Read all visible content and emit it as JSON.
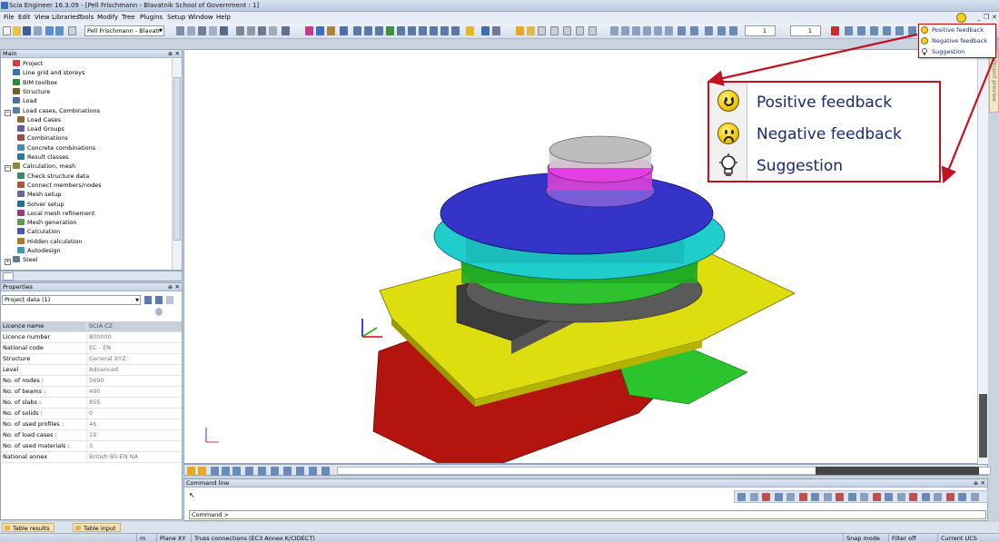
{
  "window": {
    "title": "Scia Engineer 16.3.09 - [Pell Frischmann - Blavatnik School of Government : 1]"
  },
  "menu": [
    "File",
    "Edit",
    "View",
    "Libraries",
    "Tools",
    "Modify",
    "Tree",
    "Plugins",
    "Setup",
    "Window",
    "Help"
  ],
  "window_controls": {
    "minimize": "_",
    "restore": "❒",
    "close": "✕"
  },
  "toolbar": {
    "project_combo": "Pell Frischmann - Blavatr",
    "spin1": "1",
    "spin2": "1"
  },
  "feedback_menu": {
    "items": [
      {
        "label": "Positive feedback",
        "icon": "smile-icon"
      },
      {
        "label": "Negative feedback",
        "icon": "sad-icon"
      },
      {
        "label": "Suggestion",
        "icon": "bulb-icon"
      }
    ]
  },
  "main_panel": {
    "title": "Main",
    "tree": [
      {
        "label": "Project",
        "level": 0,
        "icon": "project-icon",
        "expander": ""
      },
      {
        "label": "Line grid and storeys",
        "level": 0,
        "icon": "grid-icon",
        "expander": ""
      },
      {
        "label": "BIM toolbox",
        "level": 0,
        "icon": "bim-icon",
        "expander": ""
      },
      {
        "label": "Structure",
        "level": 0,
        "icon": "structure-icon",
        "expander": ""
      },
      {
        "label": "Load",
        "level": 0,
        "icon": "load-icon",
        "expander": ""
      },
      {
        "label": "Load cases, Combinations",
        "level": 0,
        "icon": "loadcases-icon",
        "expander": "−"
      },
      {
        "label": "Load Cases",
        "level": 1,
        "icon": "loadcase-icon",
        "expander": ""
      },
      {
        "label": "Load Groups",
        "level": 1,
        "icon": "loadgroup-icon",
        "expander": ""
      },
      {
        "label": "Combinations",
        "level": 1,
        "icon": "combination-icon",
        "expander": ""
      },
      {
        "label": "Concrete combinations",
        "level": 1,
        "icon": "concrete-combination-icon",
        "expander": ""
      },
      {
        "label": "Result classes",
        "level": 1,
        "icon": "result-class-icon",
        "expander": ""
      },
      {
        "label": "Calculation, mesh",
        "level": 0,
        "icon": "calculation-icon",
        "expander": "−"
      },
      {
        "label": "Check structure data",
        "level": 1,
        "icon": "check-icon",
        "expander": ""
      },
      {
        "label": "Connect members/nodes",
        "level": 1,
        "icon": "connect-icon",
        "expander": ""
      },
      {
        "label": "Mesh setup",
        "level": 1,
        "icon": "mesh-setup-icon",
        "expander": ""
      },
      {
        "label": "Solver setup",
        "level": 1,
        "icon": "solver-icon",
        "expander": ""
      },
      {
        "label": "Local mesh refinement",
        "level": 1,
        "icon": "refine-icon",
        "expander": ""
      },
      {
        "label": "Mesh generation",
        "level": 1,
        "icon": "mesh-gen-icon",
        "expander": ""
      },
      {
        "label": "Calculation",
        "level": 1,
        "icon": "calc-icon",
        "expander": ""
      },
      {
        "label": "Hidden calculation",
        "level": 1,
        "icon": "hidden-calc-icon",
        "expander": ""
      },
      {
        "label": "Autodesign",
        "level": 1,
        "icon": "autodesign-icon",
        "expander": ""
      },
      {
        "label": "Steel",
        "level": 0,
        "icon": "steel-icon",
        "expander": "+"
      }
    ]
  },
  "properties": {
    "title": "Properties",
    "selector": "Project data (1)",
    "rows": [
      {
        "key": "Licence name",
        "value": "SCIA CZ",
        "header": true
      },
      {
        "key": "Licence number",
        "value": "800000"
      },
      {
        "key": "National code",
        "value": "EC - EN"
      },
      {
        "key": "Structure",
        "value": "General XYZ"
      },
      {
        "key": "Level",
        "value": "Advanced"
      },
      {
        "key": "No. of nodes :",
        "value": "5690"
      },
      {
        "key": "No. of beams :",
        "value": "490"
      },
      {
        "key": "No. of slabs :",
        "value": "855"
      },
      {
        "key": "No. of solids :",
        "value": "0"
      },
      {
        "key": "No. of used profiles :",
        "value": "46"
      },
      {
        "key": "No. of load cases :",
        "value": "19"
      },
      {
        "key": "No. of used materials :",
        "value": "3"
      },
      {
        "key": "National annex",
        "value": "British BS-EN NA"
      }
    ]
  },
  "side_tab": "Project preview",
  "callout": {
    "items": [
      {
        "label": "Positive feedback"
      },
      {
        "label": "Negative feedback"
      },
      {
        "label": "Suggestion"
      }
    ]
  },
  "command": {
    "title": "Command line",
    "prompt": "Command >"
  },
  "bottom_tabs": [
    "Table results",
    "Table input"
  ],
  "status": {
    "unit": "m",
    "plane": "Plane XY",
    "connections": "Truss connections (EC3 Annex K/CIDECT)",
    "snap": "Snap mode",
    "filter": "Filter off",
    "ucs": "Current UCS"
  },
  "colors": {
    "accent_red": "#c1121f",
    "floor_red": "#b3140e",
    "floor_yellow": "#e3e300",
    "floor_green": "#2cc42c",
    "floor_cyan": "#1fd6d6",
    "floor_blue": "#3232c8",
    "floor_magenta": "#e040e0",
    "core_gray": "#555555"
  }
}
